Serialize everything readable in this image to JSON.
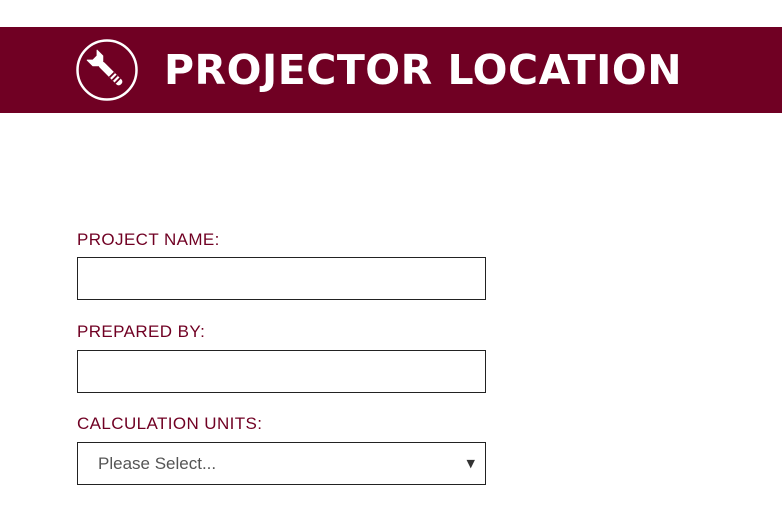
{
  "header": {
    "title": "PROJECTOR LOCATION",
    "icon": "wrench-icon",
    "background_color": "#700023",
    "text_color": "#ffffff"
  },
  "form": {
    "project_name": {
      "label": "PROJECT NAME:",
      "value": ""
    },
    "prepared_by": {
      "label": "PREPARED BY:",
      "value": ""
    },
    "calculation_units": {
      "label": "CALCULATION UNITS:",
      "selected": "Please Select..."
    },
    "label_color": "#700023"
  }
}
